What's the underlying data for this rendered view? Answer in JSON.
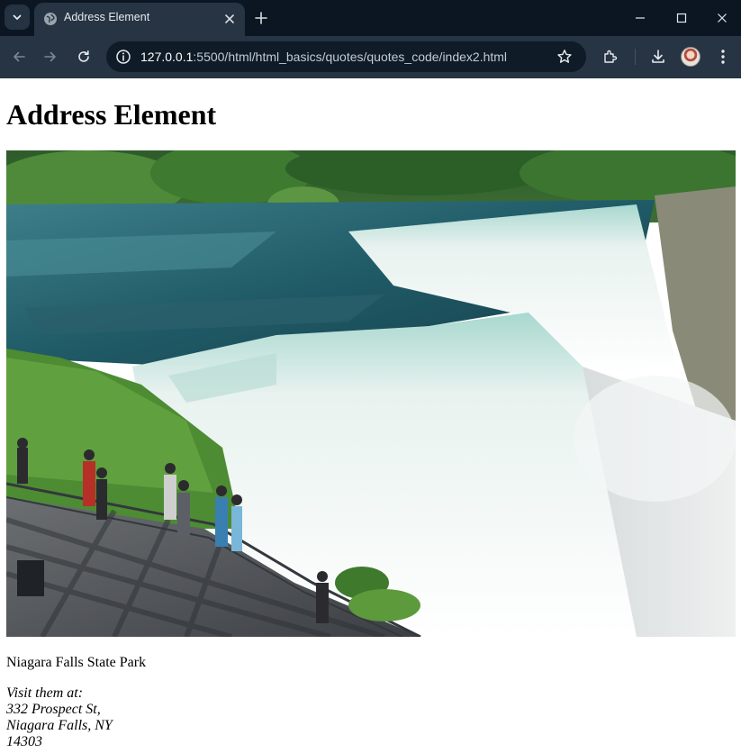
{
  "browser": {
    "tab": {
      "title": "Address Element"
    },
    "address_bar": {
      "host": "127.0.0.1",
      "path": ":5500/html/html_basics/quotes/quotes_code/index2.html"
    }
  },
  "page": {
    "heading": "Address Element",
    "image": {
      "subject": "Niagara Falls waterfall with visitors at an observation railing"
    },
    "park_name": "Niagara Falls State Park",
    "address": {
      "intro": "Visit them at:",
      "street": "332 Prospect St,",
      "city": "Niagara Falls, NY",
      "zip": "14303"
    }
  },
  "colors": {
    "tabbar_bg": "#0b1622",
    "toolbar_bg": "#263443",
    "omnibox_bg": "#0f1b27"
  },
  "icons": [
    "tab-search-icon",
    "globe-icon",
    "close-icon",
    "plus-icon",
    "minimize-icon",
    "maximize-icon",
    "window-close-icon",
    "back-arrow-icon",
    "forward-arrow-icon",
    "reload-icon",
    "info-icon",
    "star-icon",
    "extensions-icon",
    "download-icon",
    "profile-avatar",
    "more-vert-icon"
  ]
}
